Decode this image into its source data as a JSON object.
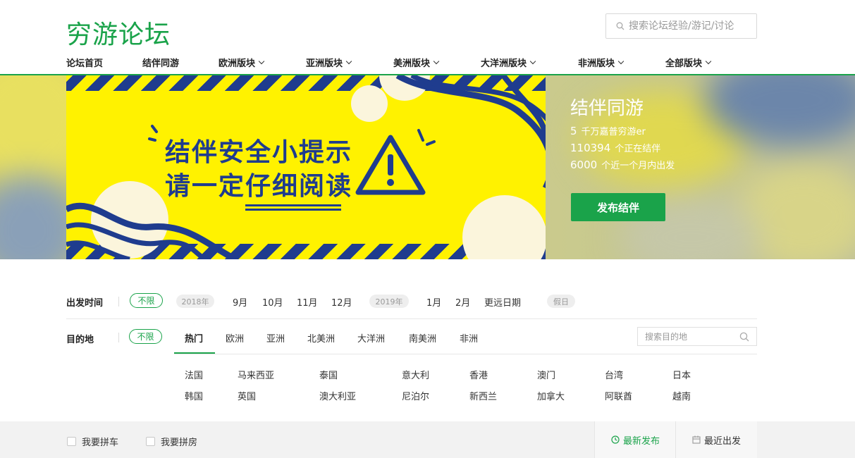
{
  "site": {
    "logo": "穷游论坛"
  },
  "search": {
    "placeholder": "搜索论坛经验/游记/讨论"
  },
  "nav": {
    "items": [
      {
        "label": "论坛首页",
        "dropdown": false
      },
      {
        "label": "结伴同游",
        "dropdown": false
      },
      {
        "label": "欧洲版块",
        "dropdown": true
      },
      {
        "label": "亚洲版块",
        "dropdown": true
      },
      {
        "label": "美洲版块",
        "dropdown": true
      },
      {
        "label": "大洋洲版块",
        "dropdown": true
      },
      {
        "label": "非洲版块",
        "dropdown": true
      },
      {
        "label": "全部版块",
        "dropdown": true
      }
    ]
  },
  "banner": {
    "poster_line1": "结伴安全小提示",
    "poster_line2": "请一定仔细阅读",
    "title": "结伴同游",
    "stat1_num": "5",
    "stat1_text": "千万嘉普穷游er",
    "stat2_num": "110394",
    "stat2_text": "个正在结伴",
    "stat3_num": "6000",
    "stat3_text": "个近一个月内出发",
    "publish_button": "发布结伴"
  },
  "filters": {
    "depart_label": "出发时间",
    "depart_unlimited": "不限",
    "year1": "2018年",
    "months1": [
      "9月",
      "10月",
      "11月",
      "12月"
    ],
    "year2": "2019年",
    "months2": [
      "1月",
      "2月"
    ],
    "later": "更远日期",
    "holiday": "假日",
    "dest_label": "目的地",
    "dest_unlimited": "不限",
    "tabs": [
      "热门",
      "欧洲",
      "亚洲",
      "北美洲",
      "大洋洲",
      "南美洲",
      "非洲"
    ],
    "dest_search_placeholder": "搜索目的地",
    "destinations_row1": [
      "法国",
      "马来西亚",
      "泰国",
      "意大利",
      "香港",
      "澳门",
      "台湾",
      "日本"
    ],
    "destinations_row2": [
      "韩国",
      "英国",
      "澳大利亚",
      "尼泊尔",
      "新西兰",
      "加拿大",
      "阿联酋",
      "越南"
    ]
  },
  "bottom": {
    "carpool": "我要拼车",
    "roomshare": "我要拼房",
    "sort_latest": "最新发布",
    "sort_departure": "最近出发"
  },
  "colors": {
    "brand_green": "#1aa34a",
    "poster_blue": "#1f3c8e",
    "poster_yellow": "#fff200"
  }
}
